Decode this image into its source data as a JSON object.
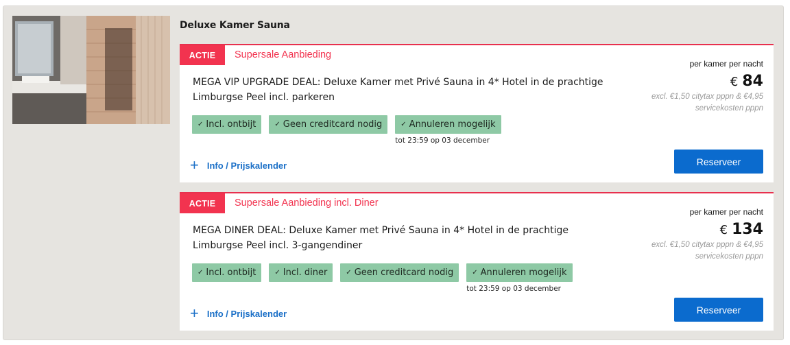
{
  "room": {
    "title": "Deluxe Kamer Sauna"
  },
  "offers": [
    {
      "tag": "ACTIE",
      "deal_title": "Supersale Aanbieding",
      "description": "MEGA VIP UPGRADE DEAL: Deluxe Kamer met Privé Sauna in 4* Hotel in de prachtige Limburgse Peel incl. parkeren",
      "badges": [
        "Incl. ontbijt",
        "Geen creditcard nodig",
        "Annuleren mogelijk"
      ],
      "cancel_note": "tot 23:59 op 03 december",
      "info_link": "Info / Prijskalender",
      "price_label": "per kamer per nacht",
      "currency": "€",
      "price": "84",
      "tax_note": "excl. €1,50 citytax pppn & €4,95 servicekosten pppn",
      "reserve_label": "Reserveer"
    },
    {
      "tag": "ACTIE",
      "deal_title": "Supersale Aanbieding incl. Diner",
      "description": "MEGA DINER DEAL: Deluxe Kamer met Privé Sauna in 4* Hotel in de prachtige Limburgse Peel incl. 3-gangendiner",
      "badges": [
        "Incl. ontbijt",
        "Incl. diner",
        "Geen creditcard nodig",
        "Annuleren mogelijk"
      ],
      "cancel_note": "tot 23:59 op 03 december",
      "info_link": "Info / Prijskalender",
      "price_label": "per kamer per nacht",
      "currency": "€",
      "price": "134",
      "tax_note": "excl. €1,50 citytax pppn & €4,95 servicekosten pppn",
      "reserve_label": "Reserveer"
    }
  ],
  "colors": {
    "accent_red": "#f2334f",
    "badge_green": "#8ec9a5",
    "button_blue": "#0b6bce",
    "link_blue": "#1a6fc7"
  }
}
